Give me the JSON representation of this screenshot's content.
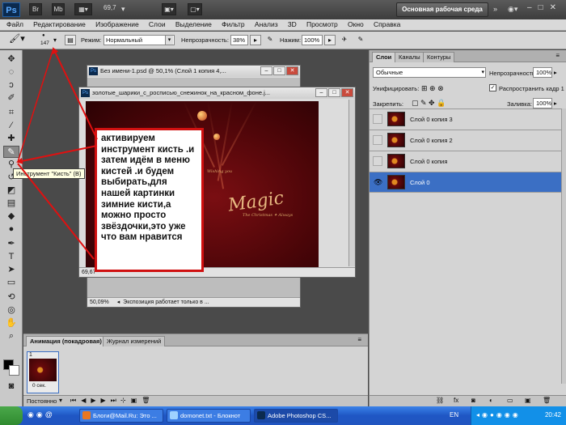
{
  "appbar": {
    "logo": "Ps",
    "zoom": "69,7",
    "workspace": "Основная рабочая среда"
  },
  "menu": [
    "Файл",
    "Редактирование",
    "Изображение",
    "Слои",
    "Выделение",
    "Фильтр",
    "Анализ",
    "3D",
    "Просмотр",
    "Окно",
    "Справка"
  ],
  "options": {
    "brush_size": "147",
    "mode_label": "Режим:",
    "mode_value": "Нормальный",
    "opacity_label": "Непрозрачность:",
    "opacity_value": "38%",
    "flow_label": "Нажим:",
    "flow_value": "100%"
  },
  "tooltip": "Инструмент \"Кисть\" (B)",
  "doc_back": {
    "title": "Без имени-1.psd @ 50,1% (Слой 1 копия 4,...",
    "zoom": "50,09%",
    "status": "Экспозиция работает только в ..."
  },
  "doc_front": {
    "title": "золотые_шарики_с_росписью_снежинок_на_красном_фоне.j...",
    "zoom": "69,67"
  },
  "canvas_text": {
    "magic": "Magic",
    "christmas": "The Christmas ✦ Always",
    "wishing": "Wishing you"
  },
  "callout": "активируем инструмент кисть .и затем идём в меню кистей .и будем выбирать,для нашей картинки зимние кисти,а можно просто звёздочки,это уже что вам нравится",
  "layers_panel": {
    "tabs": [
      "Слои",
      "Каналы",
      "Контуры"
    ],
    "blend_mode": "Обычные",
    "opacity_label": "Непрозрачность:",
    "opacity_value": "100%",
    "unify_label": "Унифицировать:",
    "propagate_label": "Распространить кадр 1",
    "lock_label": "Закрепить:",
    "fill_label": "Заливка:",
    "fill_value": "100%",
    "layers": [
      "Слой 0 копия 3",
      "Слой 0 копия 2",
      "Слой 0 копия",
      "Слой 0"
    ],
    "selected_layer": "Слой 0"
  },
  "animation_panel": {
    "tabs": [
      "Анимация (покадровая)",
      "Журнал измерений"
    ],
    "frame_number": "1",
    "frame_delay": "0 сек.",
    "loop": "Постоянно"
  },
  "taskbar": {
    "tasks": [
      "Блоги@Mail.Ru: Это ...",
      "domonet.txt - Блокнот",
      "Adobe Photoshop CS..."
    ],
    "lang": "EN",
    "clock": "20:42"
  }
}
